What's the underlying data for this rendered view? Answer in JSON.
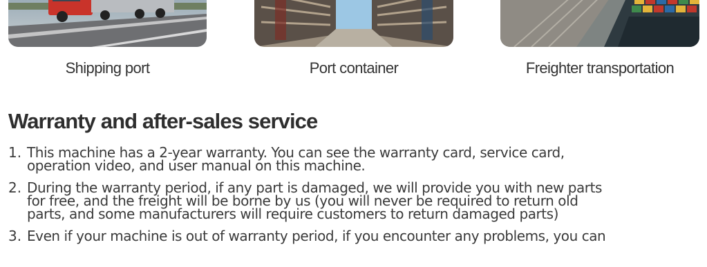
{
  "gallery": [
    {
      "icon": "truck-on-road-photo",
      "caption": "Shipping port"
    },
    {
      "icon": "container-yard-photo",
      "caption": "Port container"
    },
    {
      "icon": "container-ship-photo",
      "caption": "Freighter transportation"
    }
  ],
  "warranty": {
    "title": "Warranty and after-sales service",
    "items": [
      {
        "number": "1.",
        "text": "This machine has a 2-year warranty. You can see the warranty card, service card,\noperation video, and user manual on this machine."
      },
      {
        "number": "2.",
        "text": "During the warranty period, if any part is damaged, we will provide you with new parts\nfor free, and the freight will be borne by us (you will never be required to return old\nparts, and some manufacturers will require customers to return damaged parts)"
      },
      {
        "number": "3.",
        "text": "Even if your machine is out of warranty period, if you encounter any problems, you can"
      }
    ]
  },
  "colors": {
    "text": "#3a3a3a",
    "heading": "#2e2e2e",
    "background": "#ffffff"
  }
}
